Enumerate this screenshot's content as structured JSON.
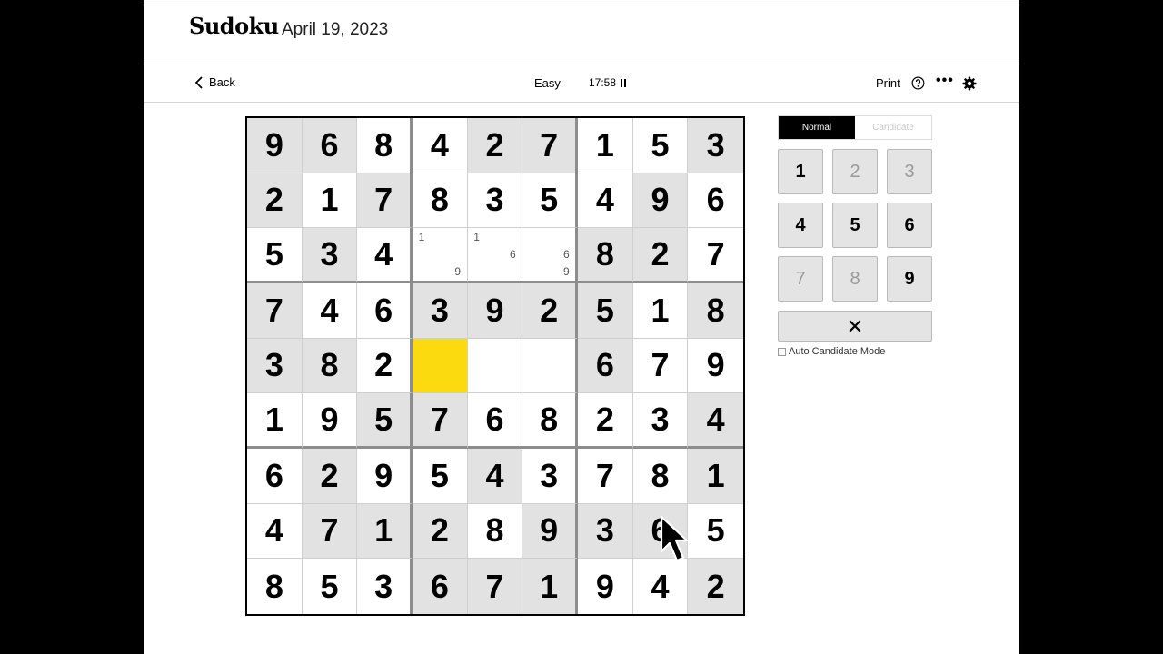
{
  "header": {
    "title": "Sudoku",
    "date": "April 19, 2023"
  },
  "toolbar": {
    "back_label": "Back",
    "difficulty": "Easy",
    "timer": "17:58",
    "print_label": "Print"
  },
  "icons": {
    "back": "chevron-left-icon",
    "pause": "pause-icon",
    "help": "help-circle-icon",
    "more": "more-dots-icon",
    "settings": "gear-icon",
    "erase": "x-icon",
    "cursor": "mouse-pointer-icon"
  },
  "colors": {
    "selected_cell": "#fbdb0f",
    "given_cell": "#e2e2e2",
    "active_mode": "#000000"
  },
  "board": {
    "values": [
      [
        9,
        6,
        8,
        4,
        2,
        7,
        1,
        5,
        3
      ],
      [
        2,
        1,
        7,
        8,
        3,
        5,
        4,
        9,
        6
      ],
      [
        5,
        3,
        4,
        0,
        0,
        0,
        8,
        2,
        7
      ],
      [
        7,
        4,
        6,
        3,
        9,
        2,
        5,
        1,
        8
      ],
      [
        3,
        8,
        2,
        0,
        0,
        0,
        6,
        7,
        9
      ],
      [
        1,
        9,
        5,
        7,
        6,
        8,
        2,
        3,
        4
      ],
      [
        6,
        2,
        9,
        5,
        4,
        3,
        7,
        8,
        1
      ],
      [
        4,
        7,
        1,
        2,
        8,
        9,
        3,
        6,
        5
      ],
      [
        8,
        5,
        3,
        6,
        7,
        1,
        9,
        4,
        2
      ]
    ],
    "givens": [
      [
        1,
        1,
        0,
        0,
        1,
        1,
        0,
        0,
        1
      ],
      [
        1,
        0,
        1,
        0,
        0,
        0,
        0,
        1,
        0
      ],
      [
        0,
        1,
        0,
        0,
        0,
        0,
        1,
        1,
        0
      ],
      [
        1,
        0,
        0,
        1,
        1,
        1,
        1,
        0,
        1
      ],
      [
        1,
        1,
        0,
        0,
        0,
        0,
        1,
        0,
        0
      ],
      [
        0,
        0,
        1,
        1,
        0,
        0,
        0,
        0,
        1
      ],
      [
        0,
        1,
        0,
        0,
        1,
        0,
        0,
        0,
        1
      ],
      [
        0,
        1,
        1,
        1,
        0,
        1,
        1,
        1,
        0
      ],
      [
        0,
        0,
        0,
        1,
        1,
        1,
        0,
        0,
        1
      ]
    ],
    "selected": [
      4,
      3
    ],
    "candidates": [
      {
        "row": 2,
        "col": 3,
        "digits": [
          1,
          9
        ]
      },
      {
        "row": 2,
        "col": 4,
        "digits": [
          1,
          6
        ]
      },
      {
        "row": 2,
        "col": 5,
        "digits": [
          6,
          9
        ]
      }
    ]
  },
  "controls": {
    "mode_normal": "Normal",
    "mode_candidate": "Candidate",
    "active_mode": "normal",
    "keys": [
      {
        "label": "1",
        "enabled": true
      },
      {
        "label": "2",
        "enabled": false
      },
      {
        "label": "3",
        "enabled": false
      },
      {
        "label": "4",
        "enabled": true
      },
      {
        "label": "5",
        "enabled": true
      },
      {
        "label": "6",
        "enabled": true
      },
      {
        "label": "7",
        "enabled": false
      },
      {
        "label": "8",
        "enabled": false
      },
      {
        "label": "9",
        "enabled": true
      }
    ],
    "auto_candidate_label": "Auto Candidate Mode",
    "auto_candidate_checked": false
  }
}
